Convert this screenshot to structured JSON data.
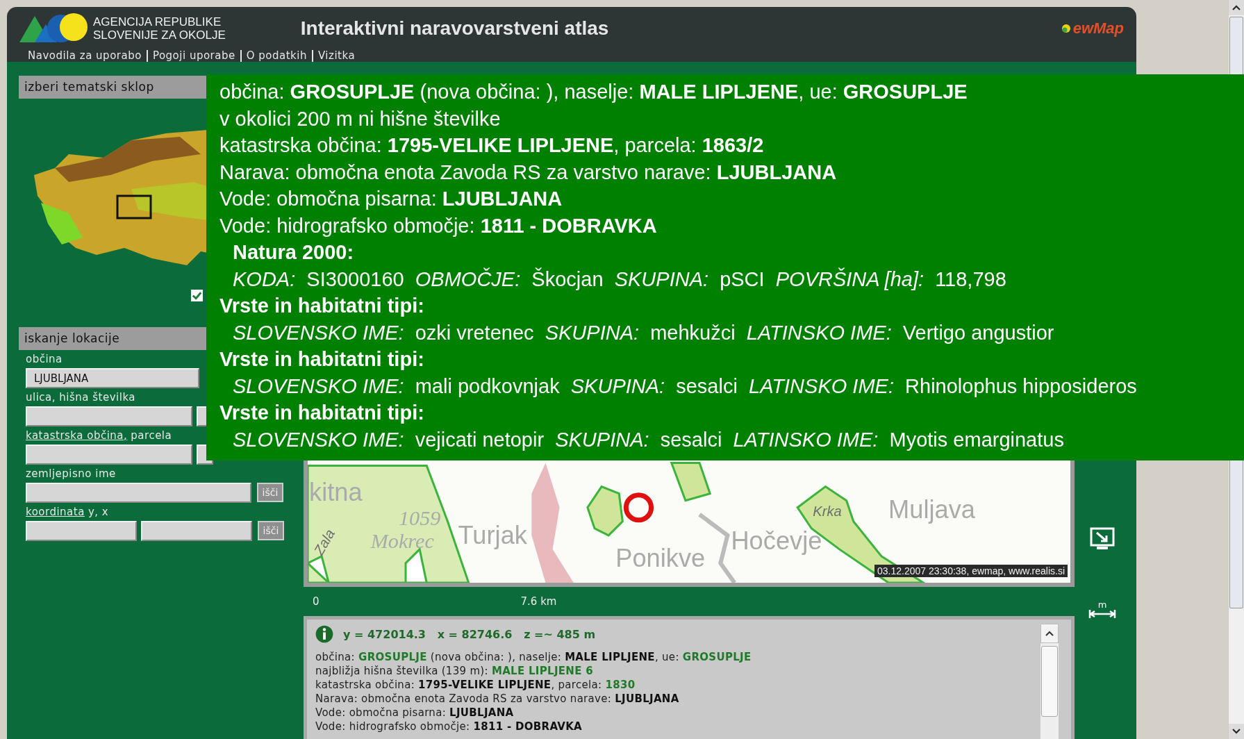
{
  "header": {
    "agency_lines": [
      "AGENCIJA  REPUBLIKE",
      "SLOVENIJE ZA OKOLJE"
    ],
    "title": "Interaktivni naravovarstveni atlas",
    "brand": "ewMap",
    "nav": [
      "Navodila za uporabo",
      "Pogoji uporabe",
      "O podatkih",
      "Vizitka"
    ]
  },
  "sidebar": {
    "theme_heading": "izberi tematski sklop",
    "overview_checked": true,
    "search_heading": "iskanje lokacije",
    "fields": [
      {
        "kind": "single",
        "label": "občina",
        "value": "LJUBLJANA"
      },
      {
        "kind": "pair",
        "label": "ulica, hišna številka"
      },
      {
        "kind": "pair",
        "link": "katastrska občina,",
        "label": "parcela"
      },
      {
        "kind": "single_search",
        "label": "zemljepisno ime",
        "button": "išči"
      },
      {
        "kind": "pair_search",
        "link": "koordinata",
        "label": "y, x",
        "button": "išči"
      }
    ]
  },
  "map": {
    "labels": [
      {
        "kind": "town",
        "text": "kitna"
      },
      {
        "kind": "water",
        "text": "Zala"
      },
      {
        "kind": "peak",
        "text": "1059"
      },
      {
        "kind": "peak",
        "text": "Mokrec"
      },
      {
        "kind": "town",
        "text": "Turjak"
      },
      {
        "kind": "town",
        "text": "Ponikve"
      },
      {
        "kind": "town",
        "text": "Hočevje"
      },
      {
        "kind": "water",
        "text": "Krka"
      },
      {
        "kind": "town",
        "text": "Muljava"
      }
    ],
    "credit": "03.12.2007 23:30:38, ewmap, www.realis.si",
    "scale": [
      "0",
      "7.6 km"
    ]
  },
  "tools": [
    {
      "kind": "fit"
    },
    {
      "kind": "measure",
      "label": "m"
    }
  ],
  "info": {
    "coords": "y = 472014.3   x = 82746.6   z =~ 485 m",
    "lines": [
      [
        {
          "kind": "text",
          "text": "občina: "
        },
        {
          "kind": "highlight",
          "text": "GROSUPLJE"
        },
        {
          "kind": "text",
          "text": " (nova občina: ), naselje: "
        },
        {
          "kind": "value",
          "text": "MALE LIPLJENE"
        },
        {
          "kind": "text",
          "text": ", ue: "
        },
        {
          "kind": "highlight",
          "text": "GROSUPLJE"
        }
      ],
      [
        {
          "kind": "text",
          "text": "najbližja hišna številka (139 m): "
        },
        {
          "kind": "highlight",
          "text": "MALE LIPLJENE 6"
        }
      ],
      [
        {
          "kind": "text",
          "text": "katastrska občina: "
        },
        {
          "kind": "value",
          "text": "1795-VELIKE LIPLJENE"
        },
        {
          "kind": "text",
          "text": ", parcela: "
        },
        {
          "kind": "highlight",
          "text": "1830"
        }
      ],
      [
        {
          "kind": "text",
          "text": "Narava: območna enota Zavoda RS za varstvo narave: "
        },
        {
          "kind": "value",
          "text": "LJUBLJANA"
        }
      ],
      [
        {
          "kind": "text",
          "text": "Vode: območna pisarna: "
        },
        {
          "kind": "value",
          "text": "LJUBLJANA"
        }
      ],
      [
        {
          "kind": "text",
          "text": "Vode: hidrografsko območje: "
        },
        {
          "kind": "value",
          "text": "1811 - DOBRAVKA"
        }
      ]
    ]
  },
  "tooltip": [
    {
      "kind": "text",
      "indent": false,
      "text": "občina: **GROSUPLJE** (nova občina: ), naselje: **MALE LIPLJENE**, ue: **GROSUPLJE**"
    },
    {
      "kind": "text",
      "indent": false,
      "text": "v okolici 200 m ni hišne številke"
    },
    {
      "kind": "text",
      "indent": false,
      "text": "katastrska občina: **1795-VELIKE LIPLJENE**, parcela: **1863/2**"
    },
    {
      "kind": "text",
      "indent": false,
      "text": "Narava: območna enota Zavoda RS za varstvo narave: **LJUBLJANA**"
    },
    {
      "kind": "text",
      "indent": false,
      "text": "Vode: območna pisarna: **LJUBLJANA**"
    },
    {
      "kind": "text",
      "indent": false,
      "text": "Vode: hidrografsko območje: **1811 - DOBRAVKA**"
    },
    {
      "kind": "heading",
      "indent": true,
      "text": "Natura 2000:"
    },
    {
      "kind": "text",
      "indent": true,
      "text": "*KODA:*  SI3000160  *OBMOČJE:*  Škocjan  *SKUPINA:*  pSCI  *POVRŠINA [ha]:*  118,798"
    },
    {
      "kind": "heading",
      "indent": false,
      "text": "Vrste in habitatni tipi:"
    },
    {
      "kind": "text",
      "indent": true,
      "text": "*SLOVENSKO IME:*  ozki vretenec  *SKUPINA:*  mehkužci  *LATINSKO IME:*  Vertigo angustior"
    },
    {
      "kind": "heading",
      "indent": false,
      "text": "Vrste in habitatni tipi:"
    },
    {
      "kind": "text",
      "indent": true,
      "text": "*SLOVENSKO IME:*  mali podkovnjak  *SKUPINA:*  sesalci  *LATINSKO IME:*  Rhinolophus hipposideros"
    },
    {
      "kind": "heading",
      "indent": false,
      "text": "Vrste in habitatni tipi:"
    },
    {
      "kind": "text",
      "indent": true,
      "text": "*SLOVENSKO IME:*  vejicati netopir  *SKUPINA:*  sesalci  *LATINSKO IME:*  Myotis emarginatus"
    }
  ]
}
